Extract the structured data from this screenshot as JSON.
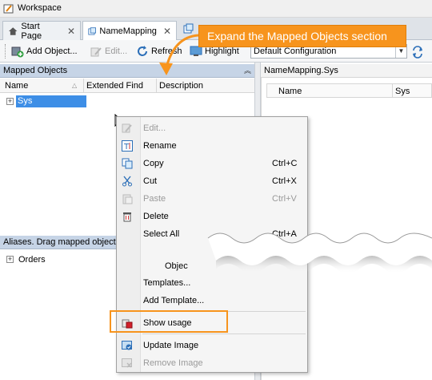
{
  "window": {
    "title": "Workspace"
  },
  "tabs": [
    {
      "label": "Start Page",
      "close": "✕"
    },
    {
      "label": "NameMapping",
      "close": "✕"
    }
  ],
  "toolbar": {
    "add_object": "Add Object...",
    "edit": "Edit...",
    "refresh": "Refresh",
    "highlight": "Highlight",
    "configuration": "Default Configuration"
  },
  "mapped_objects": {
    "title": "Mapped Objects",
    "columns": [
      "Name",
      "Extended Find",
      "Description"
    ],
    "items": [
      {
        "label": "Sys",
        "selected": true
      }
    ]
  },
  "aliases": {
    "title": "Aliases. Drag mapped objects here.",
    "items": [
      {
        "label": "Orders"
      }
    ]
  },
  "right_panel": {
    "title": "NameMapping.Sys",
    "columns": [
      "Name",
      "Sys"
    ]
  },
  "context_menu": {
    "items": [
      {
        "label": "Edit...",
        "shortcut": "",
        "icon": "edit-icon",
        "disabled": true
      },
      {
        "label": "Rename",
        "shortcut": "",
        "icon": "rename-icon",
        "disabled": false
      },
      {
        "label": "Copy",
        "shortcut": "Ctrl+C",
        "icon": "copy-icon",
        "disabled": false
      },
      {
        "label": "Cut",
        "shortcut": "Ctrl+X",
        "icon": "cut-icon",
        "disabled": false
      },
      {
        "label": "Paste",
        "shortcut": "Ctrl+V",
        "icon": "paste-icon",
        "disabled": true
      },
      {
        "label": "Delete",
        "shortcut": "",
        "icon": "delete-icon",
        "disabled": false
      },
      {
        "label": "Select All",
        "shortcut": "Ctrl+A",
        "icon": "",
        "disabled": false
      },
      {
        "label": "Objec",
        "shortcut": "",
        "icon": "",
        "disabled": false
      },
      {
        "label": "Templates...",
        "shortcut": "",
        "icon": "",
        "disabled": false
      },
      {
        "label": "Add Template...",
        "shortcut": "",
        "icon": "",
        "disabled": false
      },
      {
        "label": "Show usage",
        "shortcut": "",
        "icon": "show-usage-icon",
        "disabled": false
      },
      {
        "label": "Update Image",
        "shortcut": "",
        "icon": "update-image-icon",
        "disabled": false
      },
      {
        "label": "Remove Image",
        "shortcut": "",
        "icon": "remove-image-icon",
        "disabled": true
      }
    ]
  },
  "callout": {
    "text": "Expand the Mapped Objects section"
  },
  "colors": {
    "accent": "#f7941d",
    "selection": "#3d8ee6",
    "panel_header": "#c6d4e6"
  }
}
